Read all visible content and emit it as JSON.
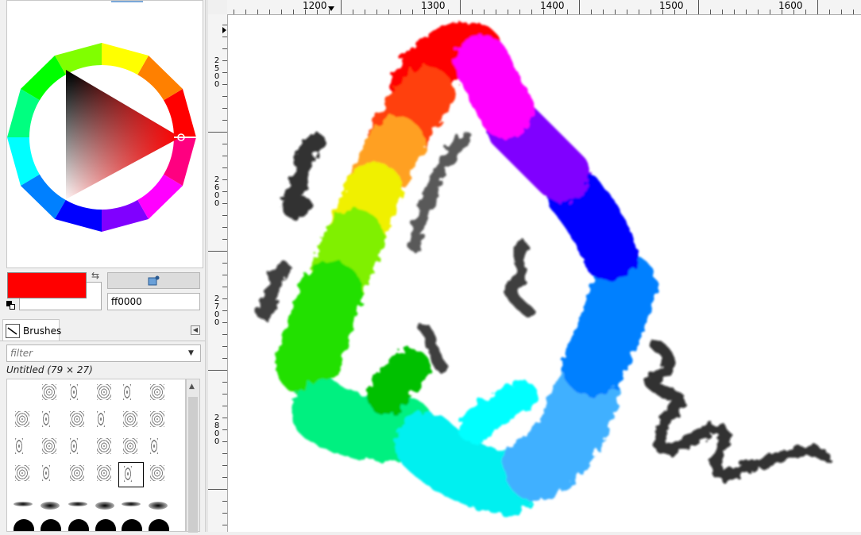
{
  "color_panel": {
    "hex_value": "ff0000",
    "foreground_color": "#ff0000",
    "background_color": "#ffffff"
  },
  "brushes_panel": {
    "tab_label": "Brushes",
    "filter_placeholder": "filter",
    "selected_brush": "Untitled (79 × 27)"
  },
  "ruler": {
    "h_labels": [
      "1200",
      "1300",
      "1400",
      "1500",
      "1600"
    ],
    "v_labels": [
      "2500",
      "2600",
      "2700",
      "2800"
    ]
  },
  "icons": [
    "swap-colors-icon",
    "reset-colors-icon",
    "color-picker-icon",
    "dropdown-arrow-icon",
    "dock-menu-icon",
    "scroll-up-icon",
    "paintbrush-icon"
  ]
}
